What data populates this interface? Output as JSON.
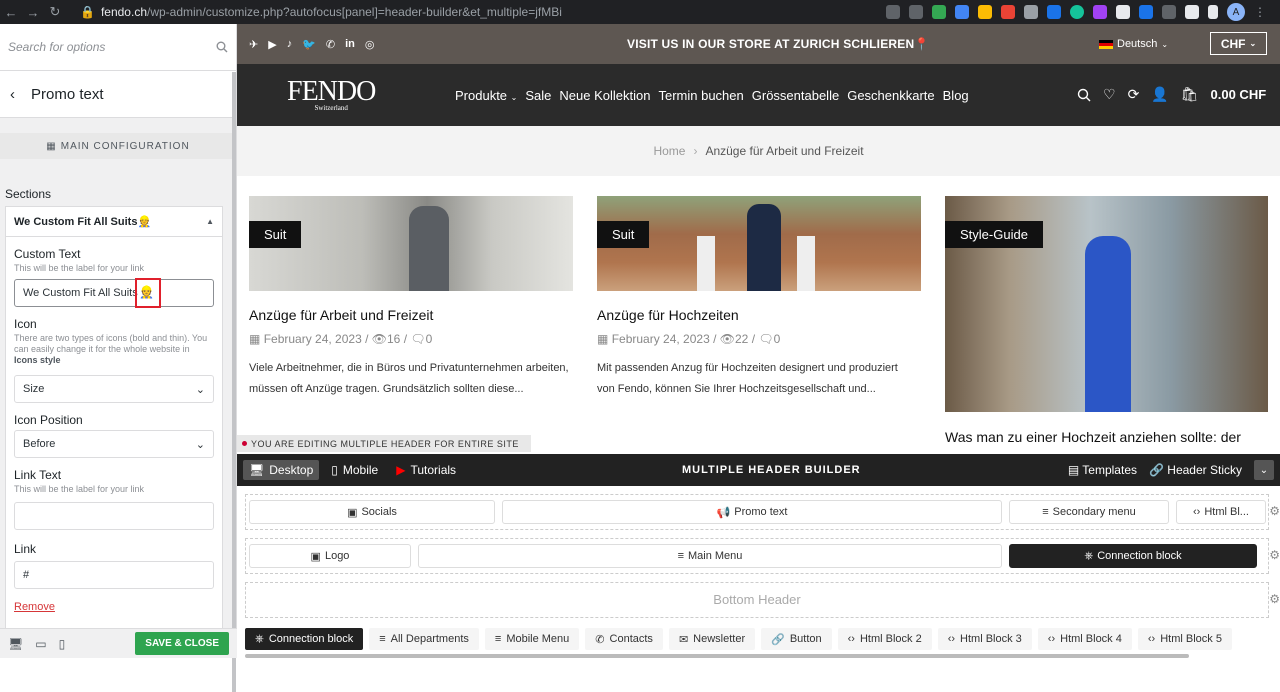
{
  "browser": {
    "url_host": "fendo.ch",
    "url_path": "/wp-admin/customize.php?autofocus[panel]=header-builder&et_multiple=jfMBi",
    "avatar": "A"
  },
  "sidebar": {
    "search_placeholder": "Search for options",
    "back_title": "Promo text",
    "main_config": "MAIN CONFIGURATION",
    "sections_label": "Sections",
    "section_title": "We Custom Fit All Suits",
    "custom_text_label": "Custom Text",
    "custom_text_desc": "This will be the label for your link",
    "custom_text_value": "We Custom Fit All Suits",
    "icon_label": "Icon",
    "icon_desc": "There are two types of icons (bold and thin). You can easily change it for the whole website in",
    "icon_desc_link": "Icons style",
    "size_value": "Size",
    "icon_position_label": "Icon Position",
    "icon_position_value": "Before",
    "link_text_label": "Link Text",
    "link_text_desc": "This will be the label for your link",
    "link_text_value": "",
    "link_label": "Link",
    "link_value": "#",
    "remove_label": "Remove",
    "save_close": "SAVE & CLOSE"
  },
  "site": {
    "promo": "VISIT US IN OUR STORE AT ZURICH SCHLIEREN",
    "language": "Deutsch",
    "currency": "CHF",
    "logo": "FENDO",
    "logo_sub": "Switzerland",
    "nav": [
      "Produkte",
      "Sale",
      "Neue Kollektion",
      "Termin buchen",
      "Grössentabelle",
      "Geschenkkarte",
      "Blog"
    ],
    "cart_total": "0.00 CHF",
    "breadcrumb_home": "Home",
    "breadcrumb_current": "Anzüge für Arbeit und Freizeit",
    "posts": [
      {
        "tag": "Suit",
        "title": "Anzüge für Arbeit und Freizeit",
        "date": "February 24, 2023",
        "views": "16",
        "comments": "0",
        "excerpt": "Viele Arbeitnehmer, die in Büros und Privatunternehmen arbeiten, müssen oft Anzüge tragen. Grundsätzlich sollten diese..."
      },
      {
        "tag": "Suit",
        "title": "Anzüge für Hochzeiten",
        "date": "February 24, 2023",
        "views": "22",
        "comments": "0",
        "excerpt": "Mit passenden Anzug für Hochzeiten designert und produziert von Fendo, können Sie Ihrer Hochzeitsgesellschaft und..."
      },
      {
        "tag": "Style-Guide",
        "title": "Was man zu einer Hochzeit anziehen sollte: der"
      }
    ],
    "editing_notice": "YOU ARE EDITING MULTIPLE HEADER FOR ENTIRE SITE"
  },
  "builder": {
    "tabs": [
      "Desktop",
      "Mobile",
      "Tutorials"
    ],
    "title": "MULTIPLE HEADER BUILDER",
    "templates": "Templates",
    "sticky": "Header Sticky",
    "row1": [
      "Socials",
      "Promo text",
      "Secondary menu",
      "Html Bl..."
    ],
    "row2": [
      "Logo",
      "Main Menu",
      "Connection block"
    ],
    "row3": "Bottom Header",
    "chips": [
      "Connection block",
      "All Departments",
      "Mobile Menu",
      "Contacts",
      "Newsletter",
      "Button",
      "Html Block 2",
      "Html Block 3",
      "Html Block 4",
      "Html Block 5"
    ]
  }
}
